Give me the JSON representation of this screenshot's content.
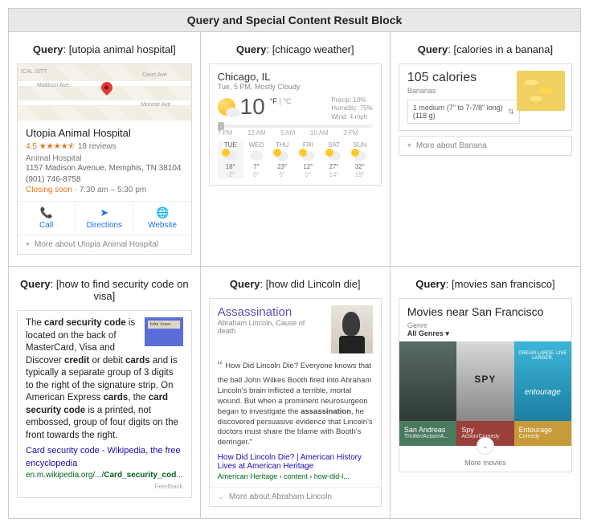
{
  "header": "Query and Special Content Result Block",
  "query_label": "Query",
  "cells": {
    "c1": {
      "query": "[utopia animal hospital]",
      "map_labels": {
        "madison": "Madison Ave",
        "court": "Court Ave",
        "monroe": "Monroe Ave",
        "ical": "ICAL ISTT"
      },
      "title": "Utopia Animal Hospital",
      "rating": "4.5",
      "stars": "★★★★⯪",
      "reviews": "18 reviews",
      "category": "Animal Hospital",
      "address": "1157 Madison Avenue, Memphis, TN 38104",
      "phone": "(901) 746-8758",
      "closing": "Closing soon",
      "hours_sep": " · ",
      "hours": "7:30 am – 5:30 pm",
      "actions": {
        "call": "Call",
        "directions": "Directions",
        "website": "Website"
      },
      "more": "More about Utopia Animal Hospital"
    },
    "c2": {
      "query": "[chicago weather]",
      "location": "Chicago, IL",
      "subtitle": "Tue, 5 PM, Mostly Cloudy",
      "temp": "10",
      "unit_f": "°F",
      "unit_sep": " | ",
      "unit_c": "°C",
      "meta": {
        "precip": "Precip: 10%",
        "humidity": "Humidity: 75%",
        "wind": "Wind: 4 mph"
      },
      "hours": [
        "7 PM",
        "12 AM",
        "5 AM",
        "10 AM",
        "3 PM"
      ],
      "days": [
        {
          "d": "TUE",
          "hi": "18°",
          "lo": "-2°",
          "sel": true,
          "icon": "sunc"
        },
        {
          "d": "WED",
          "hi": "7°",
          "lo": "0°",
          "icon": "cloud"
        },
        {
          "d": "THU",
          "hi": "23°",
          "lo": "5°",
          "icon": "sunc"
        },
        {
          "d": "FRI",
          "hi": "12°",
          "lo": "0°",
          "icon": "sunc"
        },
        {
          "d": "SAT",
          "hi": "27°",
          "lo": "14°",
          "icon": "sunc"
        },
        {
          "d": "SUN",
          "hi": "32°",
          "lo": "19°",
          "icon": "sunc"
        }
      ]
    },
    "c3": {
      "query": "[calories in a banana]",
      "value": "105 calories",
      "food": "Bananas",
      "select": "1 medium (7\" to 7-7/8\" long) (118 g)",
      "more": "More about Banana"
    },
    "c4": {
      "query": "[how to find security code on visa]",
      "text_pre": "The ",
      "b1": "card security code",
      "text_2": " is located on the back of MasterCard, Visa and Discover ",
      "b2": "credit",
      "text_3": " or debit ",
      "b3": "cards",
      "text_4": " and is typically a separate group of 3 digits to the right of the signature strip. On American Express ",
      "b4": "cards",
      "text_5": ", the ",
      "b5": "card security code",
      "text_6": " is a printed, not embossed, group of four digits on the front towards the right.",
      "link": "Card security code - Wikipedia, the free encyclopedia",
      "url_pre": "en.m.wikipedia.org/.../",
      "url_b": "Card_security_cod",
      "url_post": "...",
      "feedback": "Feedback"
    },
    "c5": {
      "query": "[how did Lincoln die]",
      "title": "Assassination",
      "subtitle": "Abraham Lincoln, Cause of death",
      "quote_pre": "How Did Lincoln Die? Everyone knows that the ball John Wilkes Booth fired into Abraham Lincoln's brain inflicted a terrible, mortal wound. But when a prominent neurosurgeon began to investigate the ",
      "quote_b": "assassination",
      "quote_post": ", he discovered persuasive evidence that Lincoln's doctors must share the blame with Booth's derringer.\"",
      "link": "How Did Lincoln Die? | American History Lives at American Heritage",
      "crumb": "American Heritage › content › how-did-l...",
      "more": "More about Abraham Lincoln"
    },
    "c6": {
      "query": "[movies san francisco]",
      "title": "Movies near San Francisco",
      "genre_label": "Genre",
      "genre": "All Genres",
      "movies": [
        {
          "t": "San Andreas",
          "g": "Thriller/Action/A..."
        },
        {
          "t": "Spy",
          "g": "Action/Comedy"
        },
        {
          "t": "Entourage",
          "g": "Comedy"
        }
      ],
      "more": "More movies"
    }
  }
}
